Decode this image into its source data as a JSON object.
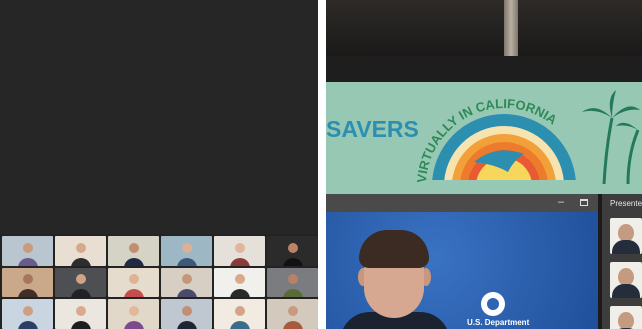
{
  "left_panel": {
    "gallery": [
      {
        "name": "",
        "bg": "#b9c6cf",
        "skin": "#c99b7d",
        "shirt": "#6a5b8f"
      },
      {
        "name": "",
        "bg": "#e9ded2",
        "skin": "#d7a98c",
        "shirt": "#2d2d2d"
      },
      {
        "name": "",
        "bg": "#d5d3c6",
        "skin": "#c18d70",
        "shirt": "#1f2b44"
      },
      {
        "name": "",
        "bg": "#9db7c5",
        "skin": "#dcb095",
        "shirt": "#3b5a7a"
      },
      {
        "name": "",
        "bg": "#e6e0da",
        "skin": "#e0b69a",
        "shirt": "#8b3a3a"
      },
      {
        "name": "",
        "bg": "#2b2b2b",
        "skin": "#b98465",
        "shirt": "#111111"
      },
      {
        "name": "",
        "bg": "#caa98a",
        "skin": "#a8765d",
        "shirt": "#3f2f27"
      },
      {
        "name": "",
        "bg": "#4e4f52",
        "skin": "#d1a387",
        "shirt": "#222222"
      },
      {
        "name": "",
        "bg": "#e5dccd",
        "skin": "#deb395",
        "shirt": "#c44d4d"
      },
      {
        "name": "",
        "bg": "#d8cfc4",
        "skin": "#c6967a",
        "shirt": "#4a4a6a"
      },
      {
        "name": "",
        "bg": "#f2f0ec",
        "skin": "#d8a98b",
        "shirt": "#2a2a2a"
      },
      {
        "name": "",
        "bg": "#7a7c80",
        "skin": "#b88268",
        "shirt": "#5a6b3a"
      },
      {
        "name": "",
        "bg": "#c9d6e1",
        "skin": "#cf9f84",
        "shirt": "#2b3f63"
      },
      {
        "name": "",
        "bg": "#ebe6df",
        "skin": "#d8aa8e",
        "shirt": "#1d1d1d"
      },
      {
        "name": "",
        "bg": "#e2d8ca",
        "skin": "#e2b89c",
        "shirt": "#7c4b8b"
      },
      {
        "name": "",
        "bg": "#bfc8d0",
        "skin": "#c18f74",
        "shirt": "#1e2633"
      },
      {
        "name": "",
        "bg": "#f1ebe2",
        "skin": "#d5a386",
        "shirt": "#3d6b8a"
      },
      {
        "name": "",
        "bg": "#d3c9bc",
        "skin": "#c99a7e",
        "shirt": "#a85a3c"
      }
    ]
  },
  "right_panel": {
    "banner": {
      "brand": "SAVERS",
      "brand_sub": "",
      "event_text": "VIRTUALLY IN CALIFORNIA"
    },
    "zoom": {
      "minimize_glyph": "–",
      "presenters_label": "Presente",
      "speaker_caption": "U.S. Department"
    }
  },
  "colors": {
    "banner_teal": "#97c8b4",
    "brand_blue": "#2c8fb0",
    "speaker_bg": "#2e64b3"
  }
}
